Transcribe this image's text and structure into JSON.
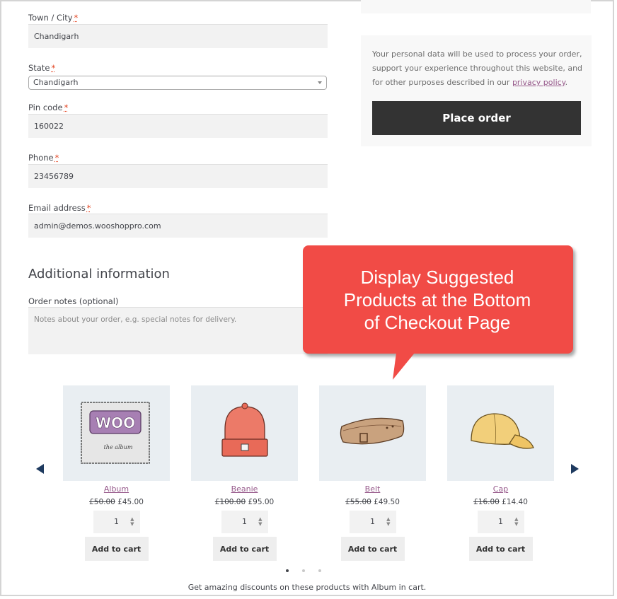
{
  "form": {
    "town_label": "Town / City",
    "town_value": "Chandigarh",
    "state_label": "State",
    "state_value": "Chandigarh",
    "pin_label": "Pin code",
    "pin_value": "160022",
    "phone_label": "Phone",
    "phone_value": "23456789",
    "email_label": "Email address",
    "email_value": "admin@demos.wooshoppro.com",
    "required_mark": "*"
  },
  "order": {
    "privacy_text": "Your personal data will be used to process your order, support your experience throughout this website, and for other purposes described in our",
    "privacy_link": "privacy policy",
    "privacy_end": ".",
    "place_order_label": "Place order"
  },
  "additional": {
    "heading": "Additional information",
    "notes_label": "Order notes (optional)",
    "notes_placeholder": "Notes about your order, e.g. special notes for delivery."
  },
  "callout": {
    "line1": "Display Suggested",
    "line2": "Products at the Bottom",
    "line3": "of Checkout Page",
    "color": "#f14b46"
  },
  "products": [
    {
      "name": "Album",
      "old_price": "£50.00",
      "price": "£45.00",
      "qty": "1",
      "button": "Add to cart",
      "icon": "album-cover-icon"
    },
    {
      "name": "Beanie",
      "old_price": "£100.00",
      "price": "£95.00",
      "qty": "1",
      "button": "Add to cart",
      "icon": "beanie-icon"
    },
    {
      "name": "Belt",
      "old_price": "£55.00",
      "price": "£49.50",
      "qty": "1",
      "button": "Add to cart",
      "icon": "belt-icon"
    },
    {
      "name": "Cap",
      "old_price": "£16.00",
      "price": "£14.40",
      "qty": "1",
      "button": "Add to cart",
      "icon": "cap-icon"
    }
  ],
  "carousel": {
    "pages": 3,
    "active_page": 1,
    "logo_text": "WOO",
    "album_caption": "the album"
  },
  "promo_text": "Get amazing discounts on these products with Album in cart."
}
